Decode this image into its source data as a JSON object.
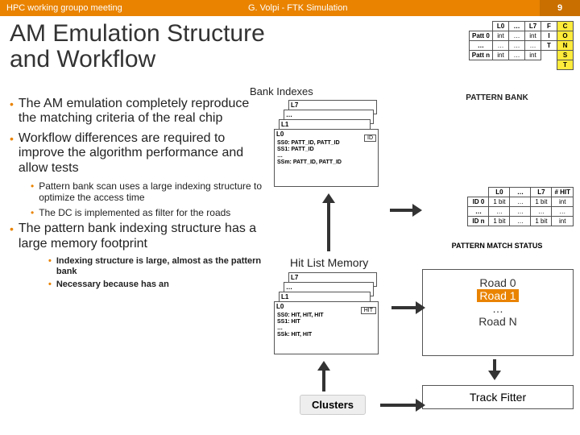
{
  "header": {
    "left": "HPC working groupo meeting",
    "center": "G. Volpi - FTK Simulation",
    "page": "9"
  },
  "title_l1": "AM Emulation Structure",
  "title_l2": "and Workflow",
  "bank_indexes": "Bank Indexes",
  "bullets": {
    "b1": "The AM emulation completely reproduce the matching criteria of the real chip",
    "b2": "Workflow differences are required to improve the algorithm performance and allow tests",
    "s1": "Pattern bank scan uses a large indexing structure to optimize the access time",
    "s2": "The DC is implemented as filter for the roads",
    "b3": "The pattern bank indexing structure has a large memory footprint",
    "ss1": "Indexing structure is large, almost as the pattern bank",
    "ss2": "Necessary because has an"
  },
  "pattern_bank": {
    "cols": {
      "c0": "L0",
      "c1": "…",
      "c2": "L7",
      "c3a": "F",
      "c3b": "I",
      "c3c": "T",
      "c4a": "C",
      "c4b": "O",
      "c4c": "N",
      "c4d": "S",
      "c4e": "T"
    },
    "r0": {
      "c0": "Patt 0",
      "c1": "int",
      "c2": "…",
      "c3": "int"
    },
    "r1": {
      "c0": "…",
      "c1": "…",
      "c2": "…",
      "c3": "…"
    },
    "r2": {
      "c0": "Patt n",
      "c1": "int",
      "c2": "…",
      "c3": "int"
    },
    "label": "PATTERN BANK"
  },
  "stack1": {
    "l7": "L7",
    "l1": "L1",
    "l0": "L0",
    "id": "ID",
    "line1": "SS0: PATT_ID, PATT_ID",
    "line2": "SS1: PATT_ID",
    "line3": "…",
    "line4": "SSm: PATT_ID, PATT_ID"
  },
  "pmstatus": {
    "cols": {
      "c0": "L0",
      "c1": "…",
      "c2": "L7",
      "c3": "# HIT"
    },
    "r0": {
      "c0": "ID 0",
      "c1": "1 bit",
      "c2": "…",
      "c3": "1 bit",
      "c4": "int"
    },
    "r1": {
      "c0": "…",
      "c1": "…",
      "c2": "…",
      "c3": "…",
      "c4": "…"
    },
    "r2": {
      "c0": "ID n",
      "c1": "1 bit",
      "c2": "…",
      "c3": "1 bit",
      "c4": "int"
    },
    "label": "PATTERN MATCH STATUS"
  },
  "hitlist_label": "Hit List Memory",
  "stack2": {
    "l7": "L7",
    "l1": "L1",
    "l0": "L0",
    "id": "HIT",
    "line1": "SS0: HIT, HIT, HIT",
    "line2": "SS1: HIT",
    "line3": "…",
    "line4": "SSk: HIT, HIT"
  },
  "clusters": "Clusters",
  "roads": {
    "r0": "Road 0",
    "r1": "Road 1",
    "rdots": "…",
    "rn": "Road N"
  },
  "fitter": "Track Fitter",
  "chart_data": {
    "type": "table",
    "tables": [
      {
        "name": "PATTERN BANK",
        "columns": [
          "",
          "L0",
          "…",
          "L7",
          "FIT CONST"
        ],
        "rows": [
          [
            "Patt 0",
            "int",
            "…",
            "int",
            ""
          ],
          [
            "…",
            "…",
            "…",
            "…",
            ""
          ],
          [
            "Patt n",
            "int",
            "…",
            "int",
            ""
          ]
        ]
      },
      {
        "name": "PATTERN MATCH STATUS",
        "columns": [
          "",
          "L0",
          "…",
          "L7",
          "# HIT"
        ],
        "rows": [
          [
            "ID 0",
            "1 bit",
            "…",
            "1 bit",
            "int"
          ],
          [
            "…",
            "…",
            "…",
            "…",
            "…"
          ],
          [
            "ID n",
            "1 bit",
            "…",
            "1 bit",
            "int"
          ]
        ]
      }
    ]
  }
}
